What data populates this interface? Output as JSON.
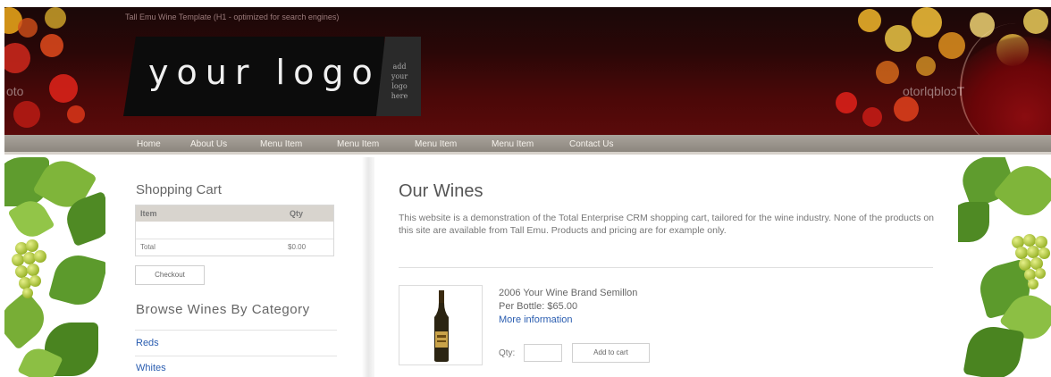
{
  "header": {
    "tagline": "Tall Emu Wine Template (H1 - optimized for search engines)",
    "logo_text": "your logo",
    "logo_side_text": "add your logo here",
    "watermark_left": "oto",
    "watermark_right": "otorlqbloɔT",
    "colors": {
      "header_bg": "#3a0808",
      "nav_bg": "#9a948c"
    }
  },
  "nav": {
    "items": [
      "Home",
      "About Us",
      "Menu Item",
      "Menu Item",
      "Menu Item",
      "Menu Item",
      "Contact Us"
    ]
  },
  "cart": {
    "title": "Shopping Cart",
    "col_item": "Item",
    "col_qty": "Qty",
    "total_label": "Total",
    "total_value": "$0.00",
    "checkout_label": "Checkout"
  },
  "browse": {
    "title": "Browse Wines By Category",
    "categories": [
      "Reds",
      "Whites"
    ]
  },
  "main": {
    "title": "Our Wines",
    "intro": "This website is a demonstration of the Total Enterprise CRM shopping cart, tailored for the wine industry. None of the products on this site are available from Tall Emu. Products and pricing are for example only.",
    "product": {
      "name": "2006 Your Wine Brand Semillon",
      "price": "Per Bottle: $65.00",
      "more_info": "More information",
      "qty_label": "Qty:",
      "qty_value": "",
      "add_label": "Add to cart"
    }
  }
}
